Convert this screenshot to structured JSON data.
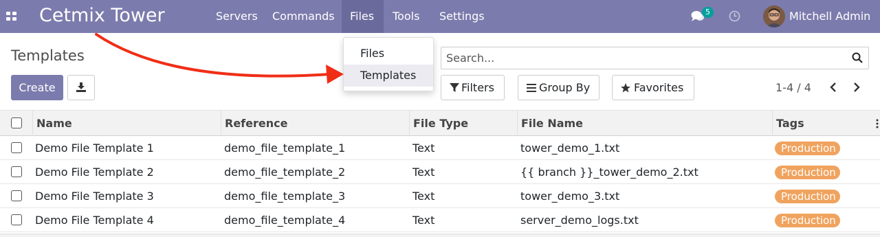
{
  "navbar": {
    "brand": "Cetmix Tower",
    "menus": [
      "Servers",
      "Commands",
      "Files",
      "Tools",
      "Settings"
    ],
    "active_menu": "Files",
    "message_count": "5",
    "user_name": "Mitchell Admin",
    "color": "#7c7bad"
  },
  "dropdown": {
    "items": [
      "Files",
      "Templates"
    ],
    "highlighted": "Templates"
  },
  "control_panel": {
    "title": "Templates",
    "create_label": "Create",
    "search_placeholder": "Search...",
    "filters_label": "Filters",
    "groupby_label": "Group By",
    "favorites_label": "Favorites",
    "pager_text": "1-4 / 4"
  },
  "table": {
    "columns": [
      "Name",
      "Reference",
      "File Type",
      "File Name",
      "Tags"
    ],
    "rows": [
      {
        "name": "Demo File Template 1",
        "reference": "demo_file_template_1",
        "file_type": "Text",
        "file_name": "tower_demo_1.txt",
        "tag": "Production"
      },
      {
        "name": "Demo File Template 2",
        "reference": "demo_file_template_2",
        "file_type": "Text",
        "file_name": "{{ branch }}_tower_demo_2.txt",
        "tag": "Production"
      },
      {
        "name": "Demo File Template 3",
        "reference": "demo_file_template_3",
        "file_type": "Text",
        "file_name": "tower_demo_3.txt",
        "tag": "Production"
      },
      {
        "name": "Demo File Template 4",
        "reference": "demo_file_template_4",
        "file_type": "Text",
        "file_name": "server_demo_logs.txt",
        "tag": "Production"
      }
    ],
    "tag_color": "#f0a35e"
  },
  "icons": {
    "apps": "apps-grid-icon",
    "messages": "chat-icon",
    "activity": "clock-icon",
    "download": "download-icon",
    "search": "search-icon",
    "filter": "filter-icon",
    "groupby": "list-icon",
    "favorites": "star-icon",
    "pager_prev": "chevron-left-icon",
    "pager_next": "chevron-right-icon"
  }
}
